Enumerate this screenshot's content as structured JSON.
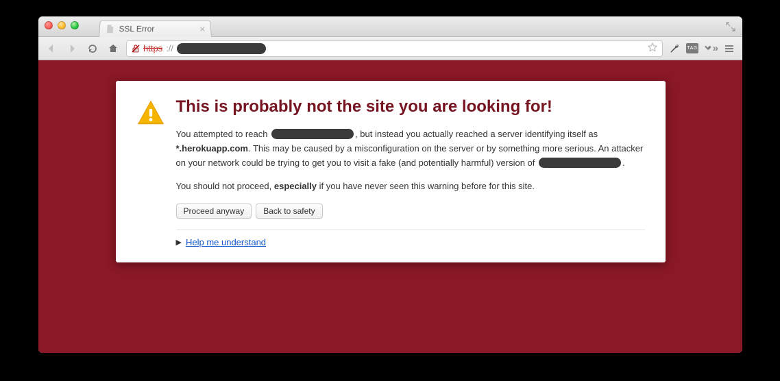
{
  "tab": {
    "title": "SSL Error"
  },
  "omnibox": {
    "scheme": "https",
    "separator": "://",
    "redacted": true
  },
  "error": {
    "heading": "This is probably not the site you are looking for!",
    "p1_a": "You attempted to reach ",
    "p1_b": ", but instead you actually reached a server identifying itself as ",
    "cert_cn": "*.herokuapp.com",
    "p1_c": ". This may be caused by a misconfiguration on the server or by something more serious. An attacker on your network could be trying to get you to visit a fake (and potentially harmful) version of ",
    "p1_d": ".",
    "p2_a": "You should not proceed, ",
    "p2_emph": "especially",
    "p2_b": " if you have never seen this warning before for this site.",
    "proceed_label": "Proceed anyway",
    "back_label": "Back to safety",
    "help_label": "Help me understand"
  },
  "toolbar_ext": {
    "tag_label": "TAG"
  }
}
